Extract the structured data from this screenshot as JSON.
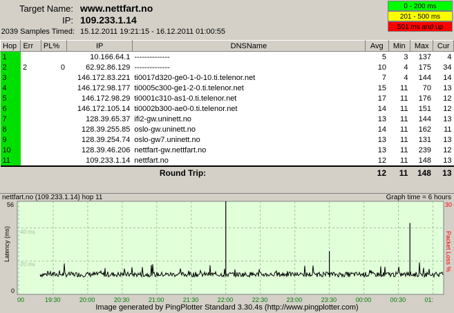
{
  "header": {
    "target_label": "Target Name:",
    "target_value": "www.nettfart.no",
    "ip_label": "IP:",
    "ip_value": "109.233.1.14",
    "samples_label": "2039 Samples Timed:",
    "samples_value": "15.12.2011 19:21:15 - 16.12.2011 01:00:55"
  },
  "legend": [
    {
      "text": "0 - 200 ms",
      "color": "#00ff00"
    },
    {
      "text": "201 - 500 ms",
      "color": "#ffff00"
    },
    {
      "text": "501 ms and up",
      "color": "#ff0000"
    }
  ],
  "columns": [
    "Hop",
    "Err",
    "PL%",
    "IP",
    "DNSName",
    "Avg",
    "Min",
    "Max",
    "Cur"
  ],
  "rows": [
    {
      "hop": "1",
      "err": "",
      "pl": "",
      "ip": "10.166.64.1",
      "dns": "--------------",
      "avg": "5",
      "min": "3",
      "max": "137",
      "cur": "4"
    },
    {
      "hop": "2",
      "err": "2",
      "pl": "0",
      "ip": "62.92.86.129",
      "dns": "--------------",
      "avg": "10",
      "min": "4",
      "max": "175",
      "cur": "34"
    },
    {
      "hop": "3",
      "err": "",
      "pl": "",
      "ip": "146.172.83.221",
      "dns": "ti0017d320-ge0-1-0-10.ti.telenor.net",
      "avg": "7",
      "min": "4",
      "max": "144",
      "cur": "14"
    },
    {
      "hop": "4",
      "err": "",
      "pl": "",
      "ip": "146.172.98.177",
      "dns": "ti0005c300-ge1-2-0.ti.telenor.net",
      "avg": "15",
      "min": "11",
      "max": "70",
      "cur": "13"
    },
    {
      "hop": "5",
      "err": "",
      "pl": "",
      "ip": "146.172.98.29",
      "dns": "ti0001c310-as1-0.ti.telenor.net",
      "avg": "17",
      "min": "11",
      "max": "176",
      "cur": "12"
    },
    {
      "hop": "6",
      "err": "",
      "pl": "",
      "ip": "146.172.105.14",
      "dns": "ti0002b300-ae0-0.ti.telenor.net",
      "avg": "14",
      "min": "11",
      "max": "151",
      "cur": "12"
    },
    {
      "hop": "7",
      "err": "",
      "pl": "",
      "ip": "128.39.65.37",
      "dns": "ifi2-gw.uninett.no",
      "avg": "13",
      "min": "11",
      "max": "144",
      "cur": "13"
    },
    {
      "hop": "8",
      "err": "",
      "pl": "",
      "ip": "128.39.255.85",
      "dns": "oslo-gw.uninett.no",
      "avg": "14",
      "min": "11",
      "max": "162",
      "cur": "11"
    },
    {
      "hop": "9",
      "err": "",
      "pl": "",
      "ip": "128.39.254.74",
      "dns": "oslo-gw7.uninett.no",
      "avg": "13",
      "min": "11",
      "max": "131",
      "cur": "13"
    },
    {
      "hop": "10",
      "err": "",
      "pl": "",
      "ip": "128.39.46.206",
      "dns": "nettfart-gw.nettfart.no",
      "avg": "13",
      "min": "11",
      "max": "239",
      "cur": "12"
    },
    {
      "hop": "11",
      "err": "",
      "pl": "",
      "ip": "109.233.1.14",
      "dns": "nettfart.no",
      "avg": "12",
      "min": "11",
      "max": "148",
      "cur": "13"
    }
  ],
  "round_trip": {
    "label": "Round Trip:",
    "avg": "12",
    "min": "11",
    "max": "148",
    "cur": "13"
  },
  "graph": {
    "title": "nettfart.no (109.233.1.14) hop 11",
    "time_label": "Graph time = 6 hours",
    "y_axis_label": "Latency (ms)",
    "y_right_label": "Packet Loss %",
    "y_max": "56",
    "y_right_max": "30",
    "y_ticks": [
      "40 ms",
      "20 ms"
    ],
    "y_zero": "0",
    "x_labels": [
      "00",
      "19:30",
      "20:00",
      "20:30",
      "21:00",
      "21:30",
      "22:00",
      "22:30",
      "23:00",
      "23:30",
      "00:00",
      "00:30",
      "01:"
    ],
    "spikes": [
      {
        "time": "22:00",
        "value": 56
      },
      {
        "time": "23:30",
        "value": 26
      },
      {
        "time": "00:40",
        "value": 43
      }
    ],
    "baseline_ms": 12
  },
  "footer": "Image generated by PingPlotter Standard 3.30.4s (http://www.pingplotter.com)"
}
